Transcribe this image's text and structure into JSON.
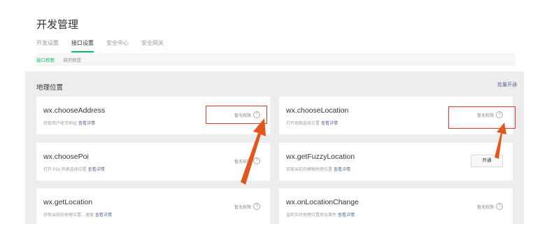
{
  "page_title": "开发管理",
  "tabs": [
    {
      "label": "开发设置",
      "active": false
    },
    {
      "label": "接口设置",
      "active": true
    },
    {
      "label": "安全中心",
      "active": false
    },
    {
      "label": "安全网关",
      "active": false
    }
  ],
  "subtabs": [
    {
      "label": "接口权限",
      "active": true
    },
    {
      "label": "调用额度",
      "active": false
    }
  ],
  "section": {
    "title": "地理位置",
    "batch_link": "批量开通"
  },
  "apis": [
    {
      "name": "wx.chooseAddress",
      "desc": "获取用户收货地址",
      "link": "查看详情",
      "action": "暂无权限",
      "highlighted": true
    },
    {
      "name": "wx.chooseLocation",
      "desc": "打开地图选择位置",
      "link": "查看详情",
      "action": "暂无权限",
      "highlighted": true
    },
    {
      "name": "wx.choosePoi",
      "desc": "打开 POI 列表选择位置",
      "link": "查看详情",
      "action": "暂无权限",
      "highlighted": false
    },
    {
      "name": "wx.getFuzzyLocation",
      "desc": "获取当前的模糊地理位置",
      "link": "查看详情",
      "button": "开通",
      "highlighted": false
    },
    {
      "name": "wx.getLocation",
      "desc": "获取当前的地理位置、速度",
      "link": "查看详情",
      "action": "暂无权限",
      "highlighted": false
    },
    {
      "name": "wx.onLocationChange",
      "desc": "监听实时地理位置变化事件",
      "link": "查看详情",
      "action": "暂无权限",
      "highlighted": false
    }
  ],
  "help_glyph": "?",
  "colors": {
    "accent": "#07c160",
    "link": "#576b95",
    "annotation": "#e0352b",
    "arrow": "#e4571c"
  }
}
